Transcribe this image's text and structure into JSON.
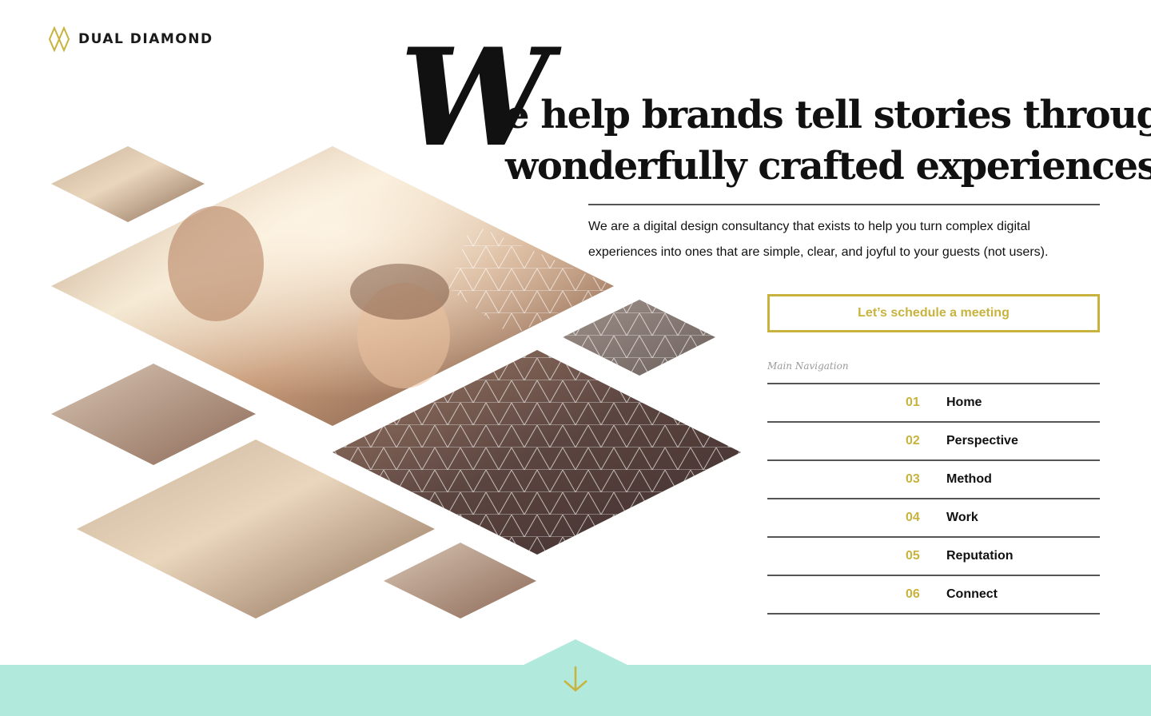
{
  "brand": {
    "name": "DUAL DIAMOND",
    "accent_color": "#c8b33e",
    "footer_color": "#b1eadd"
  },
  "hero": {
    "drop_cap": "W",
    "headline_line1": "e help brands tell stories through",
    "headline_line2": "wonderfully crafted experiences.",
    "intro": "We are a digital design consultancy that exists to help you turn complex digital experiences into ones that are simple, clear, and joyful to your guests (not users)."
  },
  "cta": {
    "label": "Let’s schedule a meeting"
  },
  "navigation": {
    "heading": "Main Navigation",
    "items": [
      {
        "number": "01",
        "label": "Home"
      },
      {
        "number": "02",
        "label": "Perspective"
      },
      {
        "number": "03",
        "label": "Method"
      },
      {
        "number": "04",
        "label": "Work"
      },
      {
        "number": "05",
        "label": "Reputation"
      },
      {
        "number": "06",
        "label": "Connect"
      }
    ]
  },
  "icons": {
    "logo": "diamond-logo-icon",
    "scroll": "down-arrow-icon"
  }
}
